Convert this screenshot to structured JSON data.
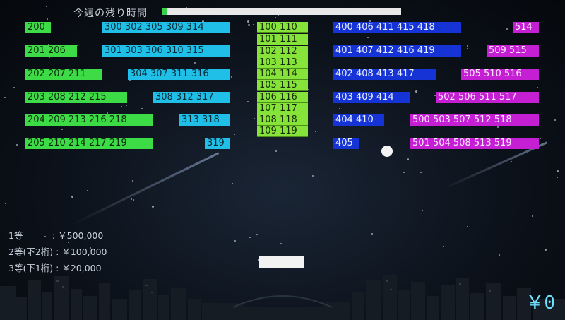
{
  "header": {
    "timer_label": "今週の残り時間",
    "timer_remaining_fraction": 0.98
  },
  "bricks": {
    "green": [
      "200",
      "201 206",
      "202 207 211",
      "203 208 212 215",
      "204 209 213 216 218",
      "205 210 214 217 219"
    ],
    "cyan": [
      "300 302 305 309 314",
      "301 303 306 310 315",
      "304 307 311 316",
      "308 312 317",
      "313 318",
      "319"
    ],
    "yellow": [
      "100 110",
      "101 111",
      "102 112",
      "103 113",
      "104 114",
      "105 115",
      "106 116",
      "107 117",
      "108 118",
      "109 119"
    ],
    "blue": [
      "400 406 411 415 418",
      "401 407 412 416 419",
      "402 408 413 417",
      "403 409 414",
      "404 410",
      "405"
    ],
    "magenta": [
      "514",
      "509 515",
      "505 510 516",
      "502 506 511 517",
      "500 503 507 512 518",
      "501 504 508 513 519"
    ]
  },
  "prizes": {
    "first": "1等　　　 : ￥500,000",
    "second": "2等(下2桁) : ￥100,000",
    "third": "3等(下1桁) : ￥20,000"
  },
  "score": "￥0",
  "colors": {
    "green": "#3ddc47",
    "cyan": "#1fbfe7",
    "yellow": "#86e33a",
    "blue": "#1634d6",
    "magenta": "#c51fd3"
  }
}
